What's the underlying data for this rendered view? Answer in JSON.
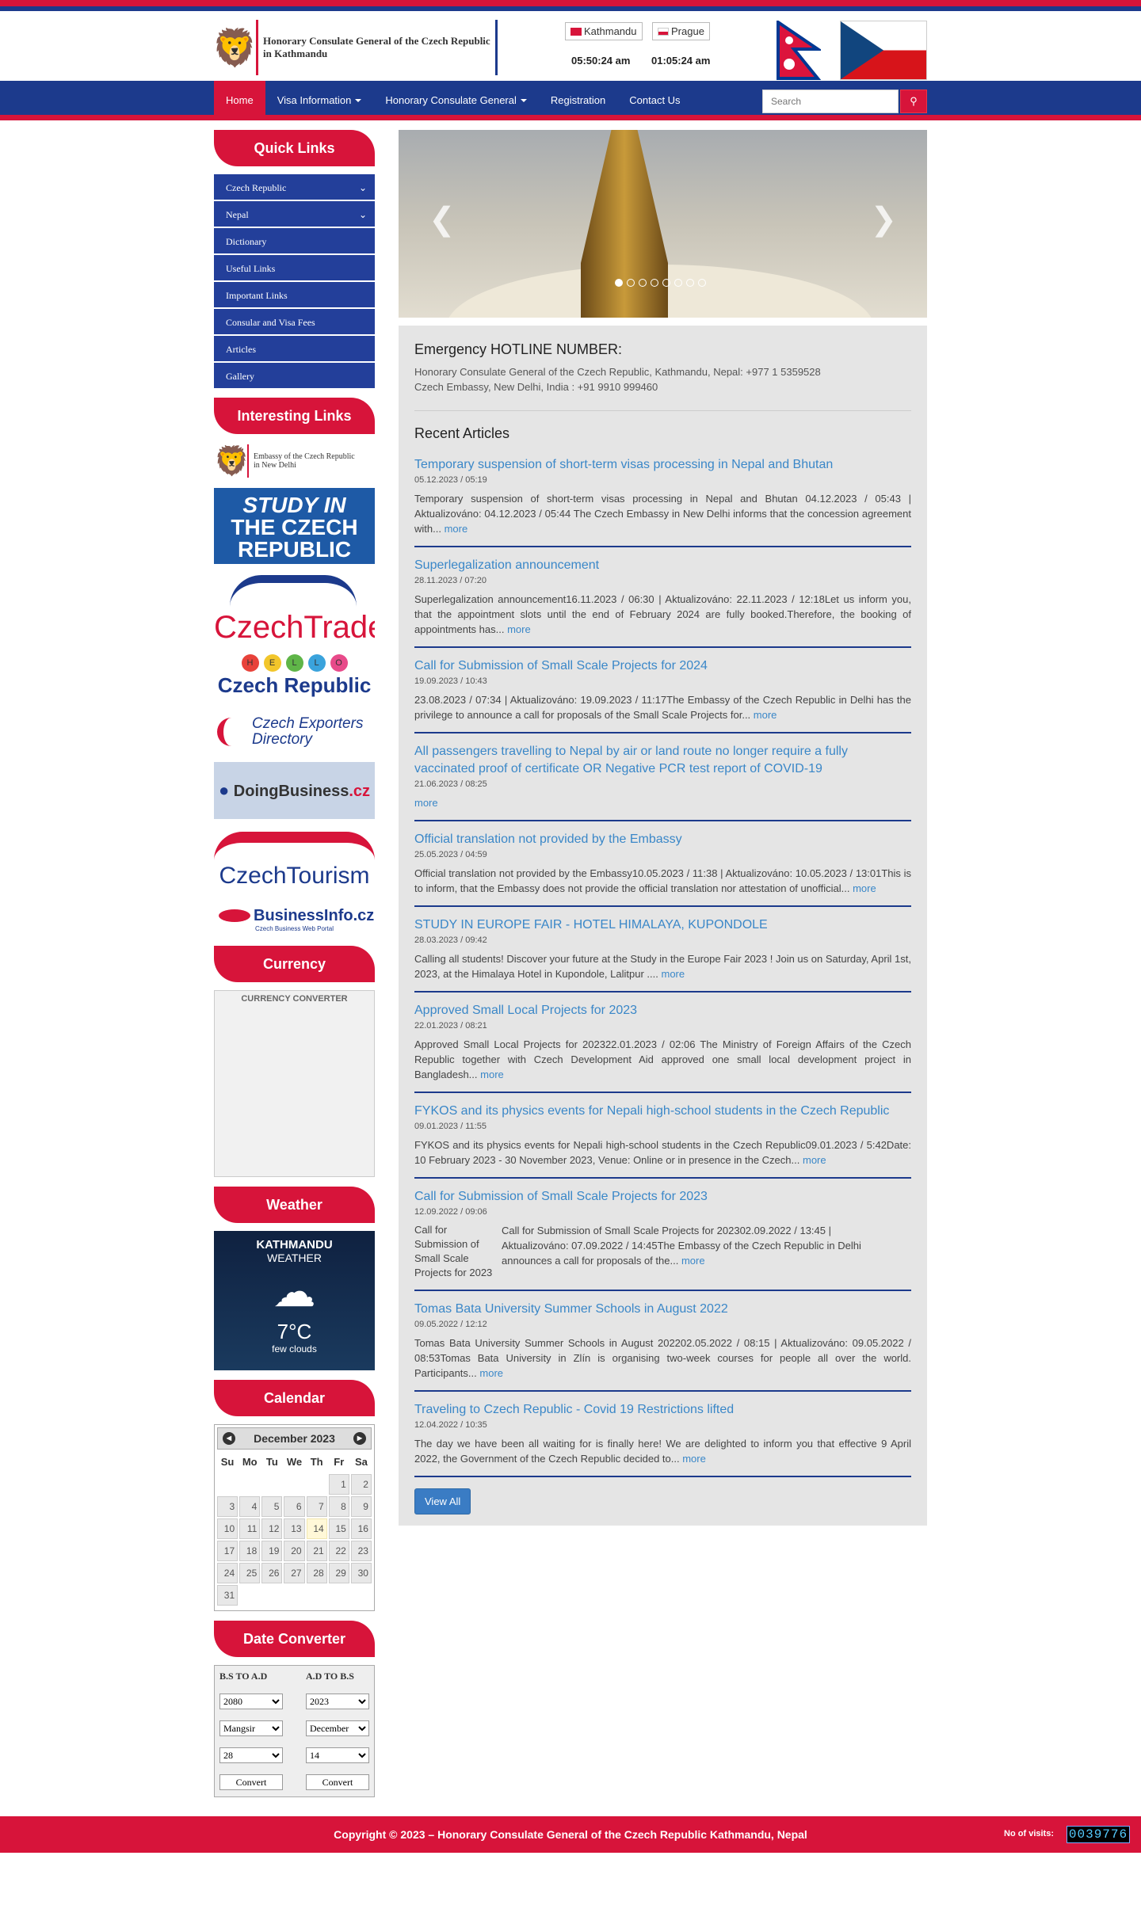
{
  "header": {
    "site_title_line1": "Honorary Consulate General of the Czech Republic",
    "site_title_line2": "in Kathmandu",
    "city1": "Kathmandu",
    "city2": "Prague",
    "time1": "05:50:24 am",
    "time2": "01:05:24 am"
  },
  "nav": {
    "home": "Home",
    "visa": "Visa Information",
    "consulate": "Honorary Consulate General",
    "registration": "Registration",
    "contact": "Contact Us",
    "search_placeholder": "Search",
    "search_icon": "search-icon",
    "active_color": "#d7143a",
    "nav_color": "#1c3a8c"
  },
  "sidebar": {
    "quick_links_title": "Quick Links",
    "quick_links": [
      {
        "label": "Czech Republic"
      },
      {
        "label": "Nepal"
      },
      {
        "label": "Dictionary"
      },
      {
        "label": "Useful Links"
      },
      {
        "label": "Important Links"
      },
      {
        "label": "Consular and Visa Fees"
      },
      {
        "label": "Articles"
      },
      {
        "label": "Gallery"
      }
    ],
    "interesting_title": "Interesting Links",
    "banners": {
      "embassy_l1": "Embassy of the Czech Republic",
      "embassy_l2": "in New Delhi",
      "study_l1": "STUDY IN",
      "study_l2": "THE CZECH",
      "study_l3": "REPUBLIC",
      "trade": "CzechTrade",
      "hello": [
        "H",
        "E",
        "L",
        "L",
        "O"
      ],
      "hello_cr": "Czech Republic",
      "exporters_l1": "Czech Exporters",
      "exporters_l2": "Directory",
      "doing_a": "DoingBusiness",
      "doing_b": ".cz",
      "tourism": "CzechTourism",
      "info": "BusinessInfo.cz",
      "info_sub": "Czech Business Web Portal"
    },
    "currency_title": "Currency",
    "currency_label": "CURRENCY CONVERTER",
    "weather_title": "Weather",
    "weather": {
      "city": "KATHMANDU",
      "label": "WEATHER",
      "temp": "7°C",
      "desc": "few clouds",
      "icon": "cloud-moon-icon"
    },
    "calendar_title": "Calendar",
    "calendar": {
      "month": "December 2023",
      "weekdays": [
        "Su",
        "Mo",
        "Tu",
        "We",
        "Th",
        "Fr",
        "Sa"
      ],
      "today": "14"
    },
    "date_converter_title": "Date Converter",
    "date_converter": {
      "bs_to_ad": "B.S TO A.D",
      "ad_to_bs": "A.D TO B.S",
      "bs_year": "2080",
      "ad_year": "2023",
      "bs_month": "Mangsir",
      "ad_month": "December",
      "bs_day": "28",
      "ad_day": "14",
      "convert": "Convert"
    }
  },
  "main": {
    "hotline_title": "Emergency HOTLINE NUMBER:",
    "hotline_line1": "Honorary Consulate General of the Czech Republic, Kathmandu, Nepal: +977 1 5359528",
    "hotline_line2": "Czech Embassy, New Delhi, India : +91 9910 999460",
    "recent_title": "Recent Articles",
    "more": "more",
    "view_all": "View All",
    "articles": [
      {
        "title": "Temporary suspension of short-term visas processing in Nepal and Bhutan",
        "date": "05.12.2023 / 05:19",
        "excerpt": "Temporary suspension of short-term visas processing in Nepal and Bhutan 04.12.2023 / 05:43 | Aktualizováno: 04.12.2023 / 05:44 The Czech Embassy in New Delhi informs that the concession agreement with..."
      },
      {
        "title": "Superlegalization announcement",
        "date": "28.11.2023 / 07:20",
        "excerpt": "Superlegalization announcement16.11.2023 / 06:30 | Aktualizováno: 22.11.2023 / 12:18Let us inform you, that the appointment slots until the end of February 2024 are fully booked.Therefore, the booking of appointments has..."
      },
      {
        "title": "Call for Submission of Small Scale Projects for 2024",
        "date": "19.09.2023 / 10:43",
        "excerpt": "23.08.2023 / 07:34 | Aktualizováno: 19.09.2023 / 11:17The Embassy of the Czech Republic in Delhi has the privilege to announce a call for proposals of the Small Scale Projects for..."
      },
      {
        "title": "All passengers travelling to Nepal by air or land route no longer require a fully vaccinated proof of certificate OR Negative PCR test report of COVID-19",
        "date": "21.06.2023 / 08:25",
        "excerpt": ""
      },
      {
        "title": "Official translation not provided by the Embassy",
        "date": "25.05.2023 / 04:59",
        "excerpt": "Official translation not provided by the Embassy10.05.2023 / 11:38 | Aktualizováno: 10.05.2023 / 13:01This is to inform, that the Embassy does not provide the official translation nor attestation of unofficial..."
      },
      {
        "title": "STUDY IN EUROPE FAIR - HOTEL HIMALAYA, KUPONDOLE",
        "date": "28.03.2023 / 09:42",
        "excerpt": "Calling all students! Discover your future at the Study in the Europe Fair 2023 ! Join us on Saturday, April 1st, 2023, at the Himalaya Hotel in Kupondole, Lalitpur ...."
      },
      {
        "title": "Approved Small Local Projects for 2023",
        "date": "22.01.2023 / 08:21",
        "excerpt": "Approved Small Local Projects for 202322.01.2023 / 02:06 The Ministry of Foreign Affairs of the Czech Republic together with Czech Development Aid approved one small local development project in Bangladesh..."
      },
      {
        "title": "FYKOS and its physics events for Nepali high-school students in the Czech Republic",
        "date": "09.01.2023 / 11:55",
        "excerpt": "FYKOS and its physics events for Nepali high-school students in the Czech Republic09.01.2023 / 5:42Date: 10 February 2023 - 30 November 2023, Venue: Online or in presence in the Czech..."
      },
      {
        "title": "Call for Submission of Small Scale Projects for 2023",
        "date": "12.09.2022 / 09:06",
        "image_alt": "Call for Submission of Small Scale Projects for 2023",
        "excerpt": "Call for Submission of Small Scale Projects for 202302.09.2022 / 13:45 | Aktualizováno: 07.09.2022 / 14:45The Embassy of the Czech Republic in Delhi announces a call for proposals of the..."
      },
      {
        "title": "Tomas Bata University Summer Schools in August 2022",
        "date": "09.05.2022 / 12:12",
        "excerpt": "Tomas Bata University Summer Schools in August 202202.05.2022 / 08:15 | Aktualizováno: 09.05.2022 / 08:53Tomas Bata University in Zlín is organising two-week courses for people all over the world. Participants..."
      },
      {
        "title": "Traveling to Czech Republic - Covid 19 Restrictions lifted",
        "date": "12.04.2022 / 10:35",
        "excerpt": "The day we have been all waiting for is finally here! We are delighted to inform you that effective 9 April 2022, the Government of the Czech Republic decided to..."
      }
    ]
  },
  "footer": {
    "copyright": "Copyright © 2023 – Honorary Consulate General of the Czech Republic Kathmandu, Nepal",
    "visits_label": "No of visits:",
    "visits_count": "0039776"
  }
}
